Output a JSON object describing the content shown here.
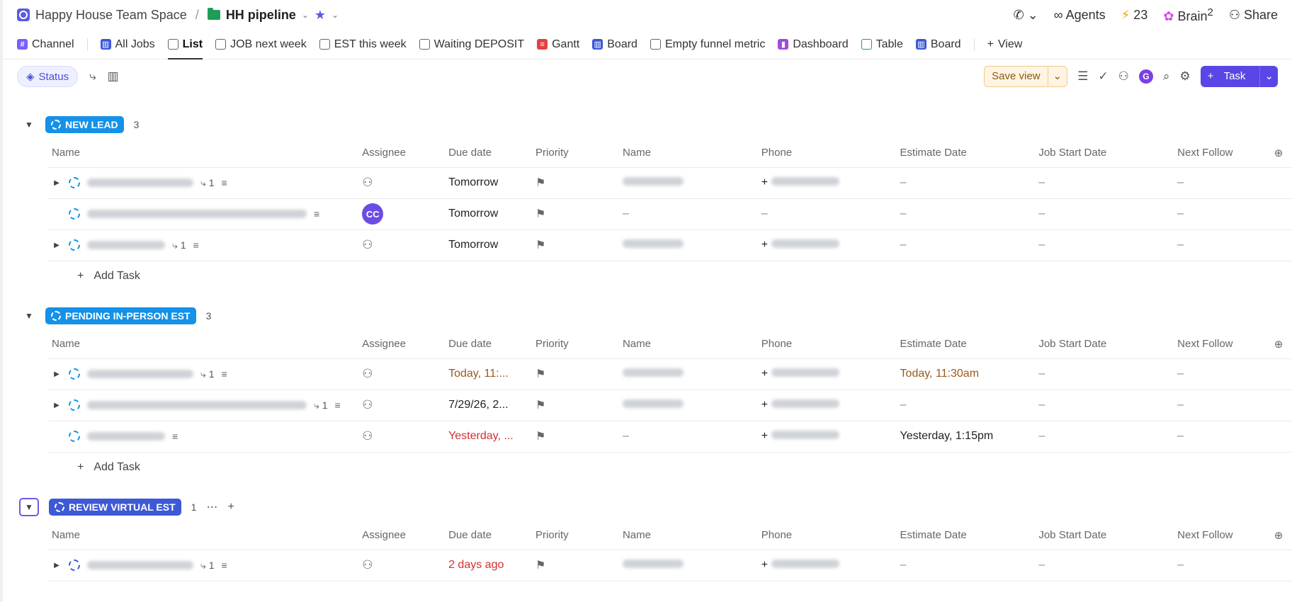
{
  "header": {
    "space_name": "Happy House Team Space",
    "separator": "/",
    "list_name": "HH pipeline",
    "agents": "Agents",
    "credits": "23",
    "brain": "Brain",
    "brain_sup": "2",
    "share": "Share"
  },
  "tabs": [
    {
      "label": "Channel",
      "icon": "hash-icon"
    },
    {
      "label": "All Jobs",
      "icon": "board-icon"
    },
    {
      "label": "List",
      "icon": "list-icon"
    },
    {
      "label": "JOB next week",
      "icon": "list-icon"
    },
    {
      "label": "EST this week",
      "icon": "list-icon"
    },
    {
      "label": "Waiting DEPOSIT",
      "icon": "list-icon"
    },
    {
      "label": "Gantt",
      "icon": "gantt-icon"
    },
    {
      "label": "Board",
      "icon": "board-icon"
    },
    {
      "label": "Empty funnel metric",
      "icon": "list-icon"
    },
    {
      "label": "Dashboard",
      "icon": "dashboard-icon"
    },
    {
      "label": "Table",
      "icon": "table-icon"
    },
    {
      "label": "Board",
      "icon": "board-icon"
    }
  ],
  "add_view": "View",
  "toolbar": {
    "status": "Status",
    "save_view": "Save view",
    "avatar_letter": "G",
    "task": "Task"
  },
  "columns": [
    "Name",
    "Assignee",
    "Due date",
    "Priority",
    "Name",
    "Phone",
    "Estimate Date",
    "Job Start Date",
    "Next Follow"
  ],
  "add_task_label": "Add Task",
  "colors": {
    "new_lead": "#1491e8",
    "pending": "#1491e8",
    "review": "#3d59d6"
  },
  "groups": [
    {
      "title": "NEW LEAD",
      "count": "3",
      "rows": [
        {
          "sub": "1",
          "assignee": "",
          "due": "Tomorrow",
          "due_style": "",
          "name2": "blur",
          "phone": "+",
          "estimate": "–",
          "est_style": "",
          "job": "–",
          "next": "–",
          "expand": true
        },
        {
          "sub": "",
          "assignee": "CC",
          "due": "Tomorrow",
          "due_style": "",
          "name2": "–",
          "phone": "–",
          "estimate": "–",
          "est_style": "",
          "job": "–",
          "next": "–",
          "expand": false
        },
        {
          "sub": "1",
          "assignee": "",
          "due": "Tomorrow",
          "due_style": "",
          "name2": "blur",
          "phone": "+",
          "estimate": "–",
          "est_style": "",
          "job": "–",
          "next": "–",
          "expand": true
        }
      ]
    },
    {
      "title": "PENDING IN-PERSON EST",
      "count": "3",
      "rows": [
        {
          "sub": "1",
          "assignee": "",
          "due": "Today, 11:...",
          "due_style": "orange",
          "name2": "blur",
          "phone": "+",
          "estimate": "Today, 11:30am",
          "est_style": "orange",
          "job": "–",
          "next": "–",
          "expand": true
        },
        {
          "sub": "1",
          "assignee": "",
          "due": "7/29/26, 2...",
          "due_style": "",
          "name2": "blur",
          "phone": "+",
          "estimate": "–",
          "est_style": "",
          "job": "–",
          "next": "–",
          "expand": true
        },
        {
          "sub": "",
          "assignee": "",
          "due": "Yesterday, ...",
          "due_style": "red",
          "name2": "–",
          "phone": "+",
          "estimate": "Yesterday, 1:15pm",
          "est_style": "",
          "job": "–",
          "next": "–",
          "expand": false
        }
      ]
    },
    {
      "title": "REVIEW VIRTUAL EST",
      "count": "1",
      "rows": [
        {
          "sub": "1",
          "assignee": "",
          "due": "2 days ago",
          "due_style": "red",
          "name2": "blur",
          "phone": "+",
          "estimate": "–",
          "est_style": "",
          "job": "–",
          "next": "–",
          "expand": true
        }
      ]
    }
  ]
}
